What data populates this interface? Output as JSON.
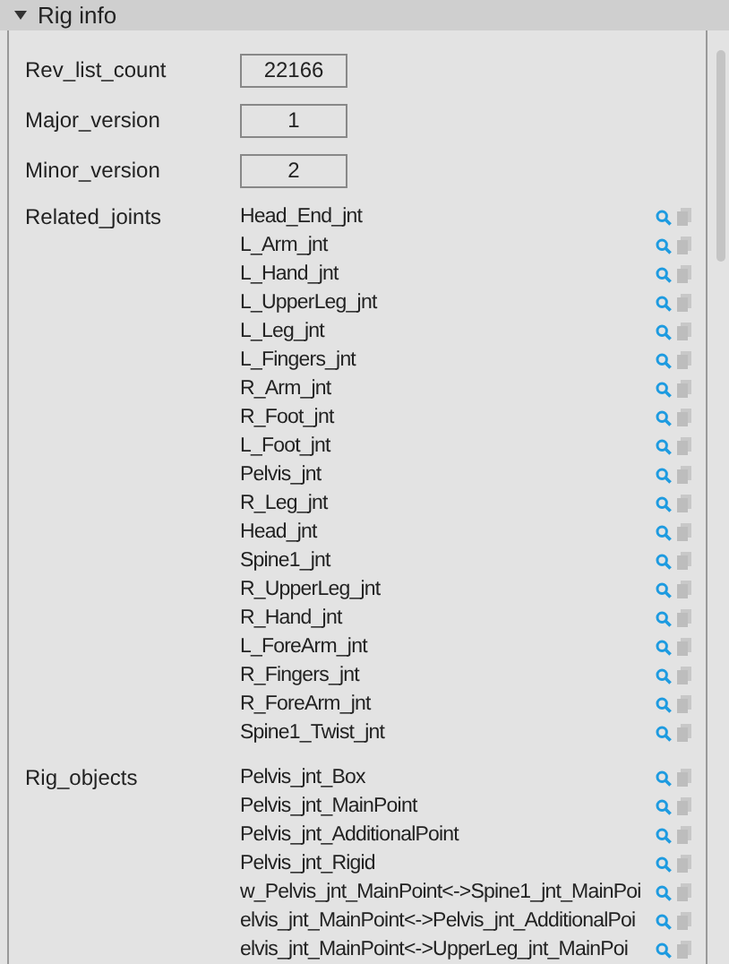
{
  "section": {
    "title": "Rig info",
    "expanded": true
  },
  "fields": [
    {
      "label": "Rev_list_count",
      "value": "22166"
    },
    {
      "label": "Major_version",
      "value": "1"
    },
    {
      "label": "Minor_version",
      "value": "2"
    }
  ],
  "lists": [
    {
      "label": "Related_joints",
      "items": [
        "Head_End_jnt",
        "L_Arm_jnt",
        "L_Hand_jnt",
        "L_UpperLeg_jnt",
        "L_Leg_jnt",
        "L_Fingers_jnt",
        "R_Arm_jnt",
        "R_Foot_jnt",
        "L_Foot_jnt",
        "Pelvis_jnt",
        "R_Leg_jnt",
        "Head_jnt",
        "Spine1_jnt",
        "R_UpperLeg_jnt",
        "R_Hand_jnt",
        "L_ForeArm_jnt",
        "R_Fingers_jnt",
        "R_ForeArm_jnt",
        "Spine1_Twist_jnt"
      ]
    },
    {
      "label": "Rig_objects",
      "items": [
        "Pelvis_jnt_Box",
        "Pelvis_jnt_MainPoint",
        "Pelvis_jnt_AdditionalPoint",
        "Pelvis_jnt_Rigid",
        "w_Pelvis_jnt_MainPoint<->Spine1_jnt_MainPoi",
        "elvis_jnt_MainPoint<->Pelvis_jnt_AdditionalPoi",
        "elvis_jnt_MainPoint<->UpperLeg_jnt_MainPoi"
      ]
    }
  ]
}
